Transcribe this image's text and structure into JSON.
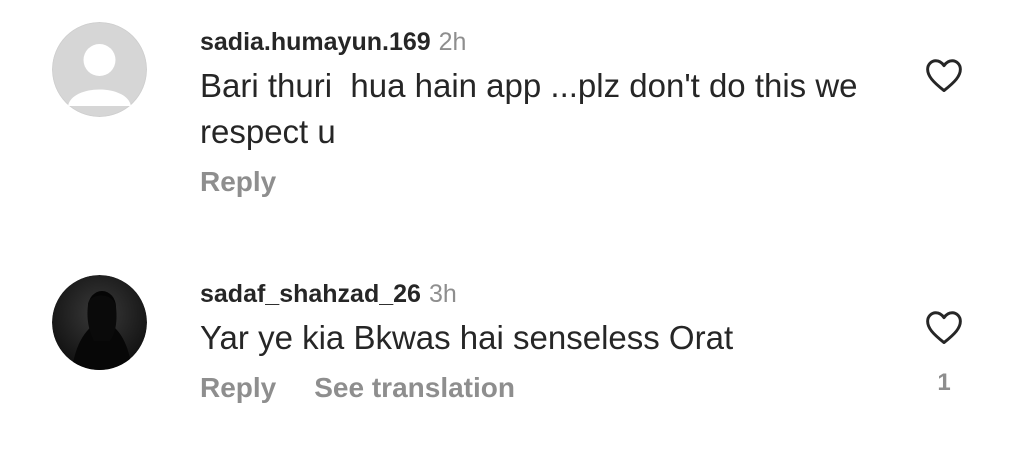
{
  "comments": [
    {
      "username": "sadia.humayun.169",
      "time": "2h",
      "text": "Bari thuri  hua hain app ...plz don't do this we respect u",
      "actions": {
        "reply": "Reply"
      },
      "avatar_icon": "default-user-avatar-icon",
      "like_icon": "heart-outline-icon",
      "like_count": ""
    },
    {
      "username": "sadaf_shahzad_26",
      "time": "3h",
      "text": "Yar ye kia Bkwas hai senseless Orat",
      "actions": {
        "reply": "Reply",
        "translate": "See translation"
      },
      "avatar_icon": "silhouette-profile-avatar-icon",
      "like_icon": "heart-outline-icon",
      "like_count": "1"
    }
  ],
  "colors": {
    "text_primary": "#262626",
    "text_secondary": "#8e8e8e",
    "background": "#ffffff"
  }
}
